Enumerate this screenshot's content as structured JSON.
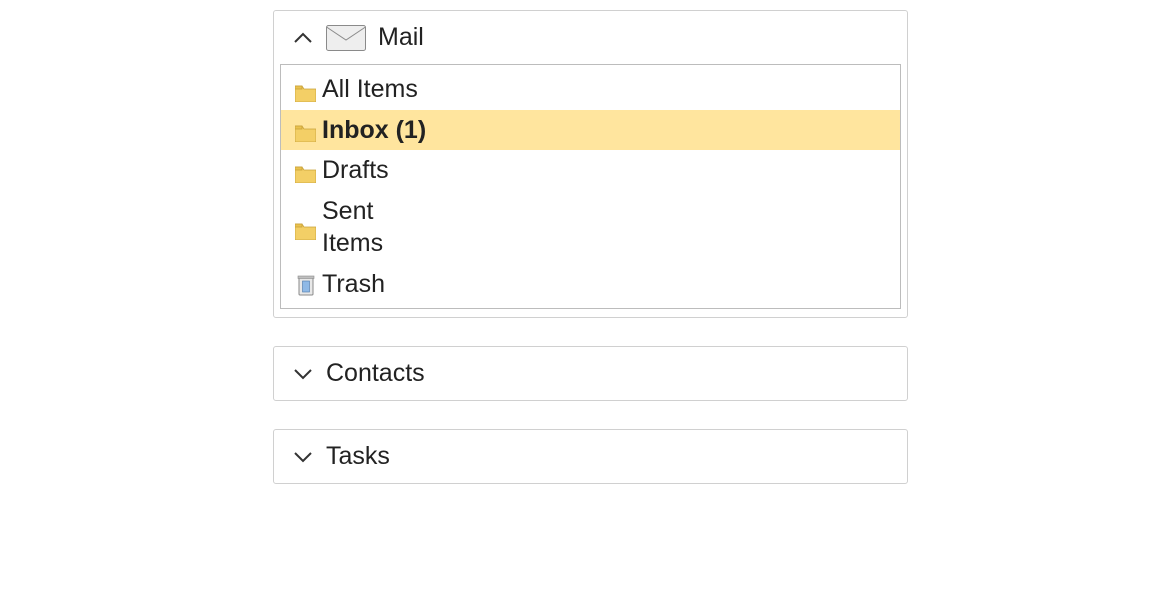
{
  "sections": {
    "mail": {
      "title": "Mail",
      "expanded": true,
      "folders": [
        {
          "label": "All Items",
          "icon": "folder",
          "selected": false
        },
        {
          "label": "Inbox (1)",
          "icon": "folder",
          "selected": true
        },
        {
          "label": "Drafts",
          "icon": "folder",
          "selected": false
        },
        {
          "label": "Sent Items",
          "icon": "folder",
          "selected": false,
          "wrap": true
        },
        {
          "label": "Trash",
          "icon": "trash",
          "selected": false
        }
      ]
    },
    "contacts": {
      "title": "Contacts",
      "expanded": false
    },
    "tasks": {
      "title": "Tasks",
      "expanded": false
    }
  }
}
